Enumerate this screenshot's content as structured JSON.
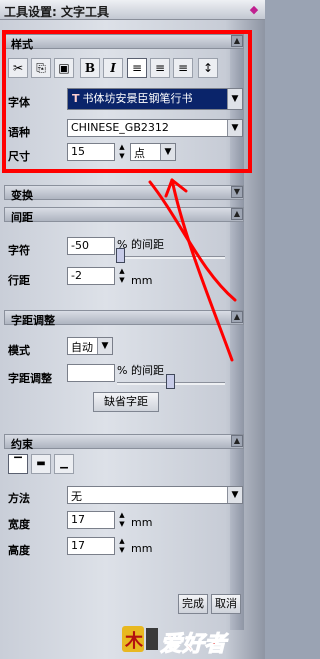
{
  "title": "工具设置: 文字工具",
  "sections": {
    "style": "样式",
    "transform": "变换",
    "spacing": "间距",
    "kerning": "字距调整",
    "constraint": "约束"
  },
  "style": {
    "font_label": "字体",
    "font_value": "书体坊安景臣钢笔行书",
    "lang_label": "语种",
    "lang_value": "CHINESE_GB2312",
    "size_label": "尺寸",
    "size_value": "15",
    "size_unit": "点"
  },
  "spacing": {
    "char_label": "字符",
    "char_value": "-50",
    "char_unit": "% 的间距",
    "line_label": "行距",
    "line_value": "-2",
    "line_unit": "mm"
  },
  "kerning": {
    "mode_label": "模式",
    "mode_value": "自动",
    "adjust_label": "字距调整",
    "adjust_value": "",
    "adjust_unit": "% 的间距",
    "default_button": "缺省字距"
  },
  "constraint": {
    "method_label": "方法",
    "method_value": "无",
    "width_label": "宽度",
    "width_value": "17",
    "width_unit": "mm",
    "height_label": "高度",
    "height_value": "17",
    "height_unit": "mm"
  },
  "footer": {
    "done": "完成",
    "cancel": "取消"
  },
  "logo_text": "爱好者",
  "colors": {
    "highlight": "#ff0000",
    "font_field_bg": "#0a246a"
  },
  "icons": [
    "cut-icon",
    "copy-icon",
    "paste-icon",
    "bold-icon",
    "italic-icon",
    "align-left-icon",
    "align-center-icon",
    "align-right-icon",
    "vertical-text-icon"
  ]
}
